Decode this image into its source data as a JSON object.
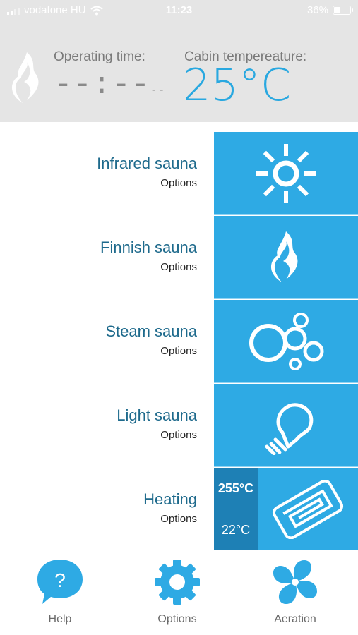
{
  "status_bar": {
    "carrier": "vodafone HU",
    "time": "11:23",
    "battery": "36%",
    "battery_level": 0.36
  },
  "header": {
    "operating_time_label": "Operating time:",
    "operating_time_value": "--:--",
    "operating_time_suffix": "--",
    "cabin_temp_label": "Cabin tempereature:",
    "cabin_temp_value": "25°C"
  },
  "saunas": [
    {
      "title": "Infrared sauna",
      "subtitle": "Options",
      "icon": "sun-icon"
    },
    {
      "title": "Finnish sauna",
      "subtitle": "Options",
      "icon": "flame-icon"
    },
    {
      "title": "Steam sauna",
      "subtitle": "Options",
      "icon": "bubbles-icon"
    },
    {
      "title": "Light sauna",
      "subtitle": "Options",
      "icon": "lightbulb-icon"
    }
  ],
  "heating": {
    "title": "Heating",
    "subtitle": "Options",
    "target_temp": "255°C",
    "current_temp": "22°C",
    "icon": "floor-heating-icon"
  },
  "bottom_nav": {
    "help": "Help",
    "options": "Options",
    "aeration": "Aeration"
  },
  "colors": {
    "accent": "#2eaae4",
    "accent_dark": "#1e80b5",
    "title_text": "#1e6a8c",
    "header_bg": "#e5e5e5"
  }
}
